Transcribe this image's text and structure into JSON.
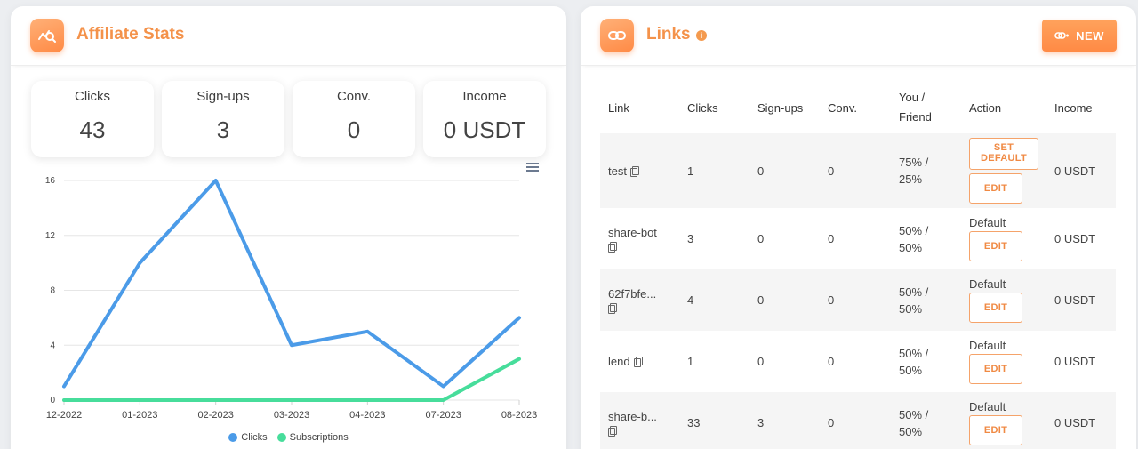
{
  "affiliate": {
    "title": "Affiliate Stats",
    "stats": [
      {
        "label": "Clicks",
        "value": "43"
      },
      {
        "label": "Sign-ups",
        "value": "3"
      },
      {
        "label": "Conv.",
        "value": "0"
      },
      {
        "label": "Income",
        "value": "0 USDT"
      }
    ]
  },
  "chart_data": {
    "type": "line",
    "categories": [
      "12-2022",
      "01-2023",
      "02-2023",
      "03-2023",
      "04-2023",
      "07-2023",
      "08-2023"
    ],
    "series": [
      {
        "name": "Clicks",
        "color": "#4b9be8",
        "values": [
          1,
          10,
          16,
          4,
          5,
          1,
          6
        ]
      },
      {
        "name": "Subscriptions",
        "color": "#47dd9b",
        "values": [
          0,
          0,
          0,
          0,
          0,
          0,
          3
        ]
      }
    ],
    "ylim": [
      0,
      16
    ],
    "yticks": [
      0,
      4,
      8,
      12,
      16
    ],
    "grid": true,
    "legend": "bottom"
  },
  "links": {
    "title": "Links",
    "info": "i",
    "new_button": "NEW",
    "columns": {
      "link": "Link",
      "clicks": "Clicks",
      "signups": "Sign-ups",
      "conv": "Conv.",
      "you_friend_1": "You /",
      "you_friend_2": "Friend",
      "action": "Action",
      "income": "Income"
    },
    "set_default_label": "SET DEFAULT",
    "edit_label": "EDIT",
    "default_label": "Default",
    "rows": [
      {
        "link": "test",
        "clicks": "1",
        "signups": "0",
        "conv": "0",
        "split_1": "75% /",
        "split_2": "25%",
        "income": "0 USDT"
      },
      {
        "link": "share-bot",
        "clicks": "3",
        "signups": "0",
        "conv": "0",
        "split_1": "50% /",
        "split_2": "50%",
        "income": "0 USDT"
      },
      {
        "link": "62f7bfe...",
        "clicks": "4",
        "signups": "0",
        "conv": "0",
        "split_1": "50% /",
        "split_2": "50%",
        "income": "0 USDT"
      },
      {
        "link": "lend",
        "clicks": "1",
        "signups": "0",
        "conv": "0",
        "split_1": "50% /",
        "split_2": "50%",
        "income": "0 USDT"
      },
      {
        "link": "share-b...",
        "clicks": "33",
        "signups": "3",
        "conv": "0",
        "split_1": "50% /",
        "split_2": "50%",
        "income": "0 USDT"
      }
    ]
  }
}
